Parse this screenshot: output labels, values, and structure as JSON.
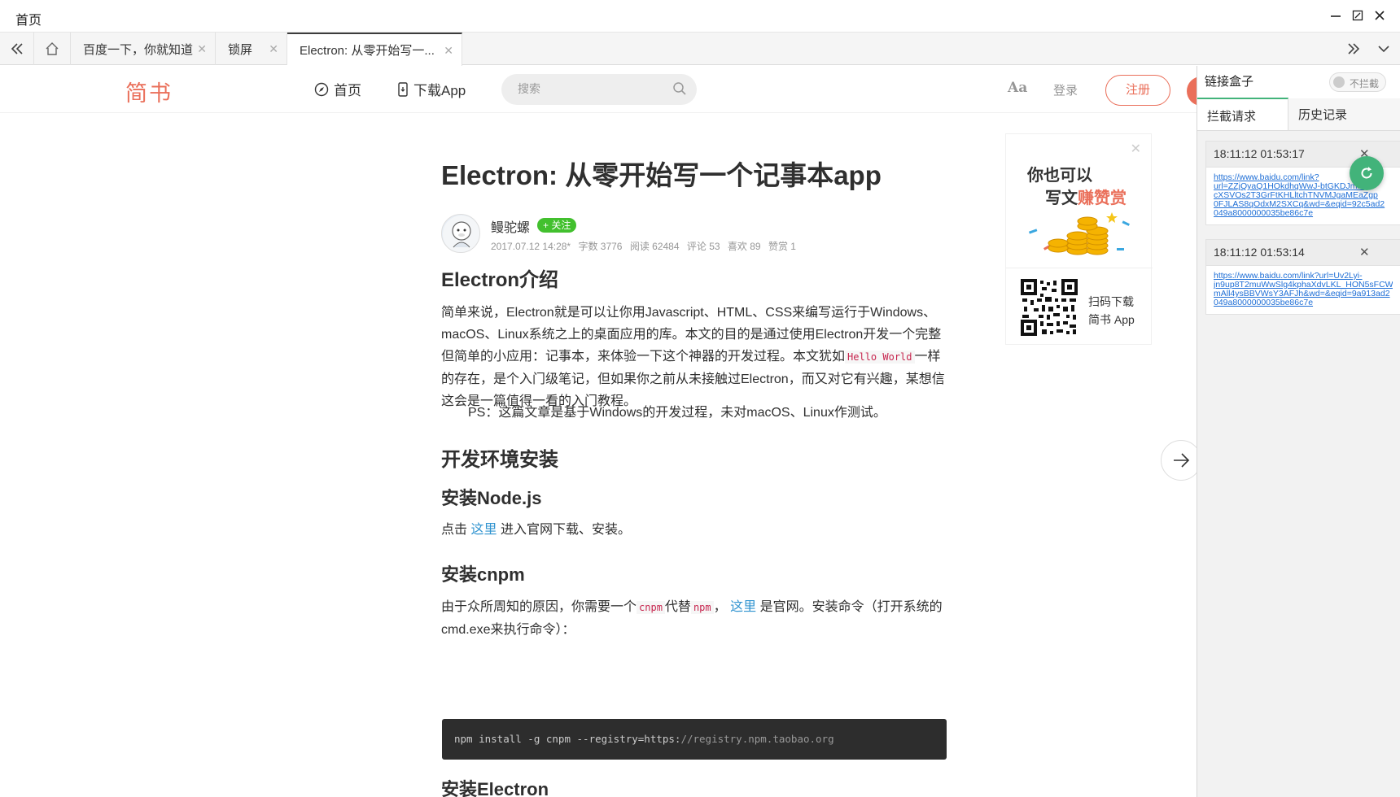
{
  "window": {
    "title": "首页"
  },
  "tabs": [
    {
      "label": "百度一下，你就知道"
    },
    {
      "label": "锁屏"
    },
    {
      "label": "Electron: 从零开始写一..."
    }
  ],
  "site": {
    "logo": "简书",
    "nav_home": "首页",
    "nav_download": "下载App",
    "search_placeholder": "搜索",
    "font_toggle": "Aa",
    "login": "登录",
    "register": "注册"
  },
  "article": {
    "title": "Electron: 从零开始写一个记事本app",
    "author": "鳗驼螺",
    "follow": "+ 关注",
    "meta": {
      "date": "2017.07.12 14:28*",
      "words": "字数 3776",
      "reads": "阅读 62484",
      "comments": "评论 53",
      "likes": "喜欢 89",
      "rewards": "赞赏 1"
    },
    "h_intro": "Electron介绍",
    "intro_p1": "简单来说，Electron就是可以让你用Javascript、HTML、CSS来编写运行于Windows、macOS、Linux系统之上的桌面应用的库。本文的目的是通过使用Electron开发一个完整但简单的小应用：记事本，来体验一下这个神器的开发过程。本文犹如",
    "intro_code": "Hello World",
    "intro_p2": "一样的存在，是个入门级笔记，但如果你之前从未接触过Electron，而又对它有兴趣，某想信这会是一篇值得一看的入门教程。",
    "intro_ps": "PS：这篇文章是基于Windows的开发过程，未对macOS、Linux作测试。",
    "h_env": "开发环境安装",
    "h_node": "安装Node.js",
    "node_p_pre": "点击",
    "node_link": "这里",
    "node_p_post": "进入官网下载、安装。",
    "h_cnpm": "安装cnpm",
    "cnpm_p1": "由于众所周知的原因，你需要一个",
    "cnpm_code1": "cnpm",
    "cnpm_p2": "代替",
    "cnpm_code2": "npm",
    "cnpm_p3": "，",
    "cnpm_link": "这里",
    "cnpm_p4": "是官网。安装命令（打开系统的cmd.exe来执行命令）：",
    "code_cmd": "npm install -g cnpm --registry=https:",
    "code_url": "//registry.npm.taobao.org",
    "h_electron": "安装Electron"
  },
  "ad": {
    "line1": "你也可以",
    "line2_pre": "写文",
    "line2_hl": "赚赞赏",
    "download1": "扫码下载",
    "download2": "简书 App"
  },
  "panel": {
    "title": "链接盒子",
    "toggle": "不拦截",
    "tab_intercept": "拦截请求",
    "tab_history": "历史记录",
    "requests": [
      {
        "time": "18:11:12 01:53:17",
        "url_lines": [
          "https://www.baidu.com/link?",
          "url=ZZjQyaQ1HOkdhqWwJ-btGKDJmm",
          "cXSVOs2T3GrFtKHLltchTNVMJgaMEaZgp",
          "0FJLAS8qOdxM2SXCq&wd=&eqid=92c5ad2",
          "049a8000000035be86c7e"
        ]
      },
      {
        "time": "18:11:12 01:53:14",
        "url_lines": [
          "https://www.baidu.com/link?url=Uv2Lyi-",
          "jn9up8T2muWwSlg4kphaXdvLKL_HON5sFCW",
          "mAll4ysBBVWsY3AFJh&wd=&eqid=9a913ad2",
          "049a8000000035be86c7e"
        ]
      }
    ]
  }
}
